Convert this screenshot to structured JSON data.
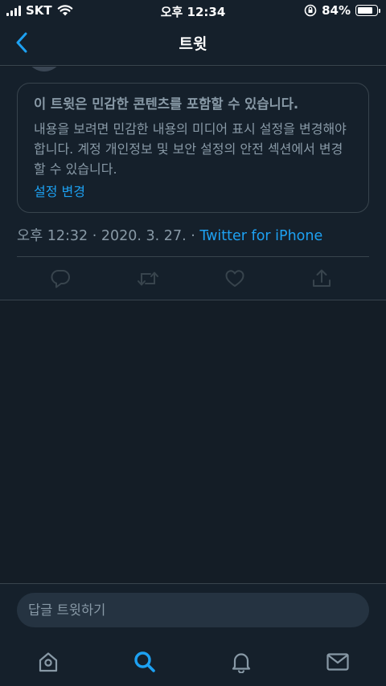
{
  "status_bar": {
    "carrier": "SKT",
    "time": "오후 12:34",
    "battery_percent": "84%",
    "battery_level": 0.84
  },
  "nav": {
    "title": "트윗",
    "back_icon": "chevron-left-icon"
  },
  "warning": {
    "title": "이 트윗은 민감한 콘텐츠를 포함할 수 있습니다.",
    "body": "내용을 보려면 민감한 내용의 미디어 표시 설정을 변경해야 합니다. 계정 개인정보 및 보안 설정의 안전 섹션에서 변경할 수 있습니다.",
    "link": "설정 변경"
  },
  "tweet_meta": {
    "timestamp": "오후 12:32 · 2020. 3. 27. · ",
    "source": "Twitter for iPhone"
  },
  "actions": [
    "reply-icon",
    "retweet-icon",
    "like-icon",
    "share-icon"
  ],
  "reply": {
    "placeholder": "답글 트윗하기"
  },
  "tabs": [
    "home-icon",
    "search-icon",
    "notifications-icon",
    "messages-icon"
  ],
  "colors": {
    "accent": "#1da1f2",
    "background": "#15202b",
    "muted_text": "#8899a6",
    "border": "#38444d"
  }
}
